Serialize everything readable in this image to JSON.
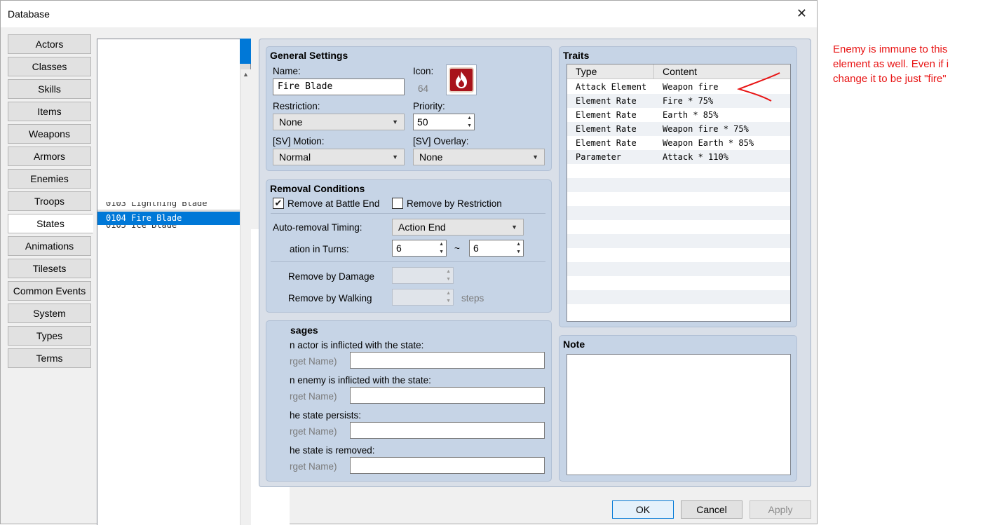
{
  "window": {
    "title": "Database",
    "close_glyph": "✕"
  },
  "tabs": [
    "Actors",
    "Classes",
    "Skills",
    "Items",
    "Weapons",
    "Armors",
    "Enemies",
    "Troops",
    "States",
    "Animations",
    "Tilesets",
    "Common Events",
    "System",
    "Types",
    "Terms"
  ],
  "active_tab": "States",
  "list": {
    "partial_above": "0103 Lightning Blade",
    "selected": "0104 Fire Blade",
    "partial_below": "0105 Ice Blade"
  },
  "general": {
    "title": "General Settings",
    "name_label": "Name:",
    "name_value": "Fire Blade",
    "icon_label": "Icon:",
    "icon_index": "64",
    "restriction_label": "Restriction:",
    "restriction_value": "None",
    "priority_label": "Priority:",
    "priority_value": "50",
    "motion_label": "[SV] Motion:",
    "motion_value": "Normal",
    "overlay_label": "[SV] Overlay:",
    "overlay_value": "None"
  },
  "removal": {
    "title": "Removal Conditions",
    "battle_end_label": "Remove at Battle End",
    "battle_end_checked": "✔",
    "restriction_label": "Remove by Restriction",
    "timing_label": "Auto-removal Timing:",
    "timing_value": "Action End",
    "duration_label": "ation in Turns:",
    "duration_min": "6",
    "tilde": "~",
    "duration_max": "6",
    "damage_label": "Remove by Damage",
    "walking_label": "Remove by Walking",
    "steps_label": "steps"
  },
  "messages": {
    "title": "sages",
    "actor_label": "n actor is inflicted with the state:",
    "enemy_label": "n enemy is inflicted with the state:",
    "persists_label": "he state persists:",
    "removed_label": "he state is removed:",
    "target_placeholder": "rget Name)"
  },
  "traits": {
    "title": "Traits",
    "col_type": "Type",
    "col_content": "Content",
    "rows": [
      {
        "type": "Attack Element",
        "content": "Weapon fire"
      },
      {
        "type": "Element Rate",
        "content": "Fire * 75%"
      },
      {
        "type": "Element Rate",
        "content": "Earth * 85%"
      },
      {
        "type": "Element Rate",
        "content": "Weapon fire * 75%"
      },
      {
        "type": "Element Rate",
        "content": "Weapon Earth * 85%"
      },
      {
        "type": "Parameter",
        "content": "Attack * 110%"
      }
    ]
  },
  "note": {
    "title": "Note"
  },
  "buttons": {
    "ok": "OK",
    "cancel": "Cancel",
    "apply": "Apply"
  },
  "annotation": {
    "text": "Enemy is immune to this element as well. Even if i change it to be just \"fire\"",
    "color": "#e81414"
  },
  "icons": {
    "spin_up": "▲",
    "spin_down": "▼",
    "caret": "▼",
    "scroll_up": "▲"
  }
}
